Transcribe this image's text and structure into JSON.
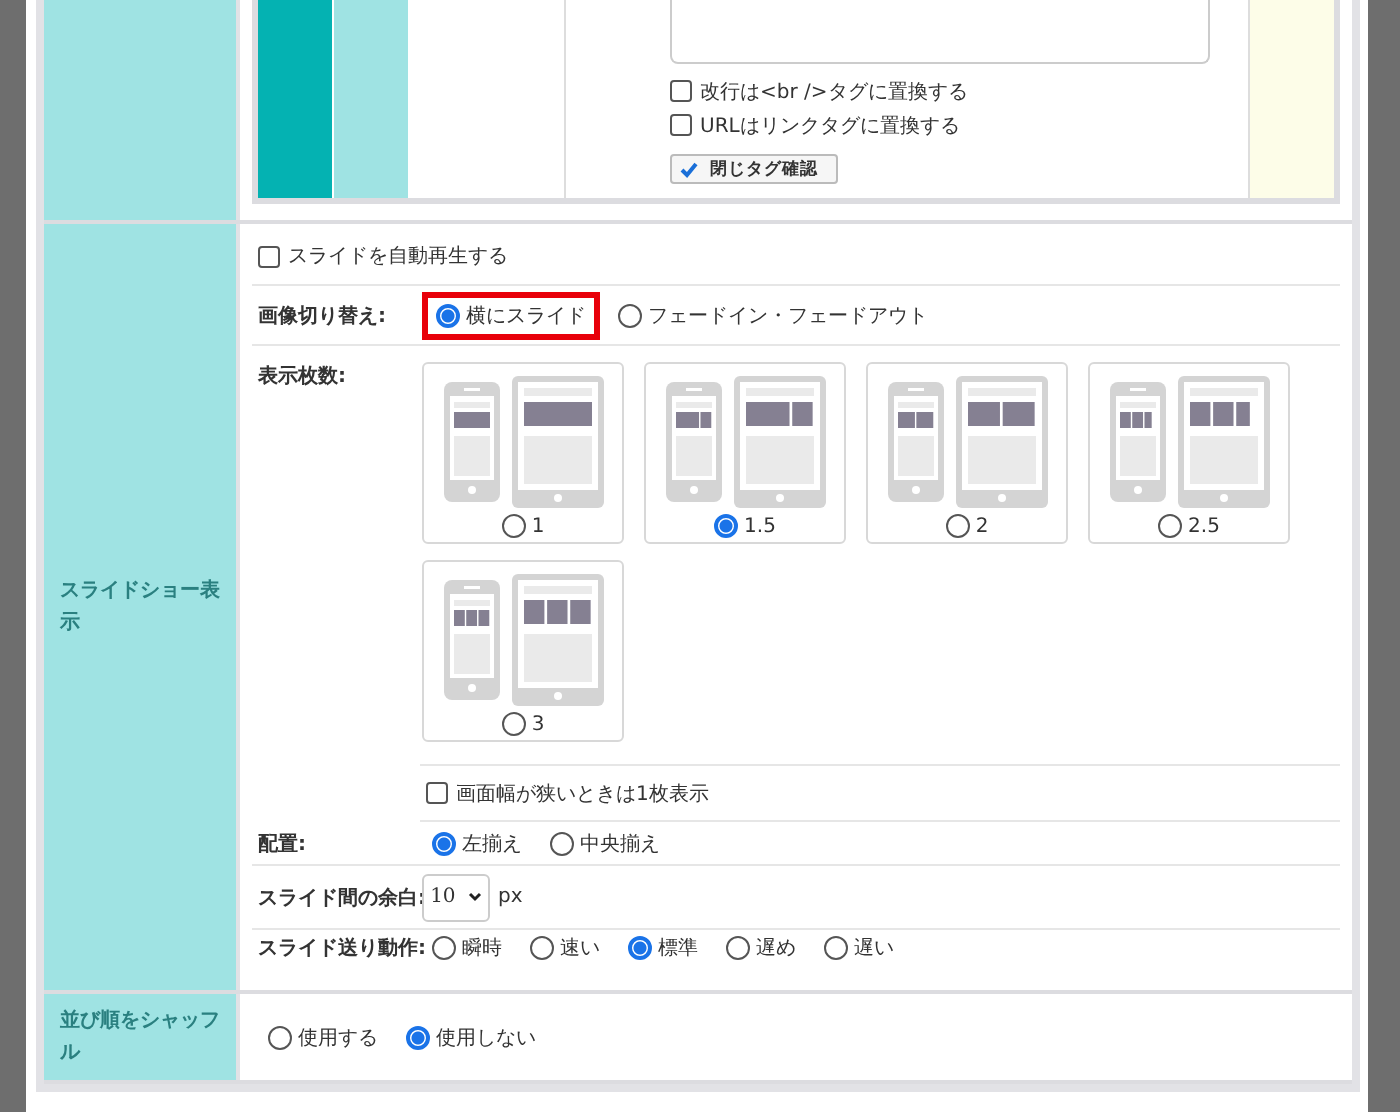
{
  "editor": {
    "options": [
      {
        "label": "改行は<br />タグに置換する",
        "checked": false
      },
      {
        "label": "URLはリンクタグに置換する",
        "checked": false
      }
    ],
    "button": {
      "label": "閉じタグ確認"
    }
  },
  "slideshow": {
    "label": "スライドショー表示",
    "autoplay": {
      "label": "スライドを自動再生する",
      "checked": false
    },
    "switch": {
      "label": "画像切り替え:",
      "options": [
        {
          "label": "横にスライド",
          "selected": true,
          "highlighted": true
        },
        {
          "label": "フェードイン・フェードアウト",
          "selected": false,
          "highlighted": false
        }
      ]
    },
    "count": {
      "label": "表示枚数:",
      "options": [
        {
          "label": "1",
          "selected": false
        },
        {
          "label": "1.5",
          "selected": true
        },
        {
          "label": "2",
          "selected": false
        },
        {
          "label": "2.5",
          "selected": false
        },
        {
          "label": "3",
          "selected": false
        }
      ]
    },
    "narrow": {
      "label": "画面幅が狭いときは1枚表示",
      "checked": false
    },
    "align": {
      "label": "配置:",
      "options": [
        {
          "label": "左揃え",
          "selected": true
        },
        {
          "label": "中央揃え",
          "selected": false
        }
      ]
    },
    "spacing": {
      "label": "スライド間の余白:",
      "value": "10",
      "unit": "px"
    },
    "speed": {
      "label": "スライド送り動作:",
      "options": [
        {
          "label": "瞬時",
          "selected": false
        },
        {
          "label": "速い",
          "selected": false
        },
        {
          "label": "標準",
          "selected": true
        },
        {
          "label": "遅め",
          "selected": false
        },
        {
          "label": "遅い",
          "selected": false
        }
      ]
    }
  },
  "shuffle": {
    "label": "並び順をシャッフル",
    "options": [
      {
        "label": "使用する",
        "selected": false
      },
      {
        "label": "使用しない",
        "selected": true
      }
    ]
  }
}
